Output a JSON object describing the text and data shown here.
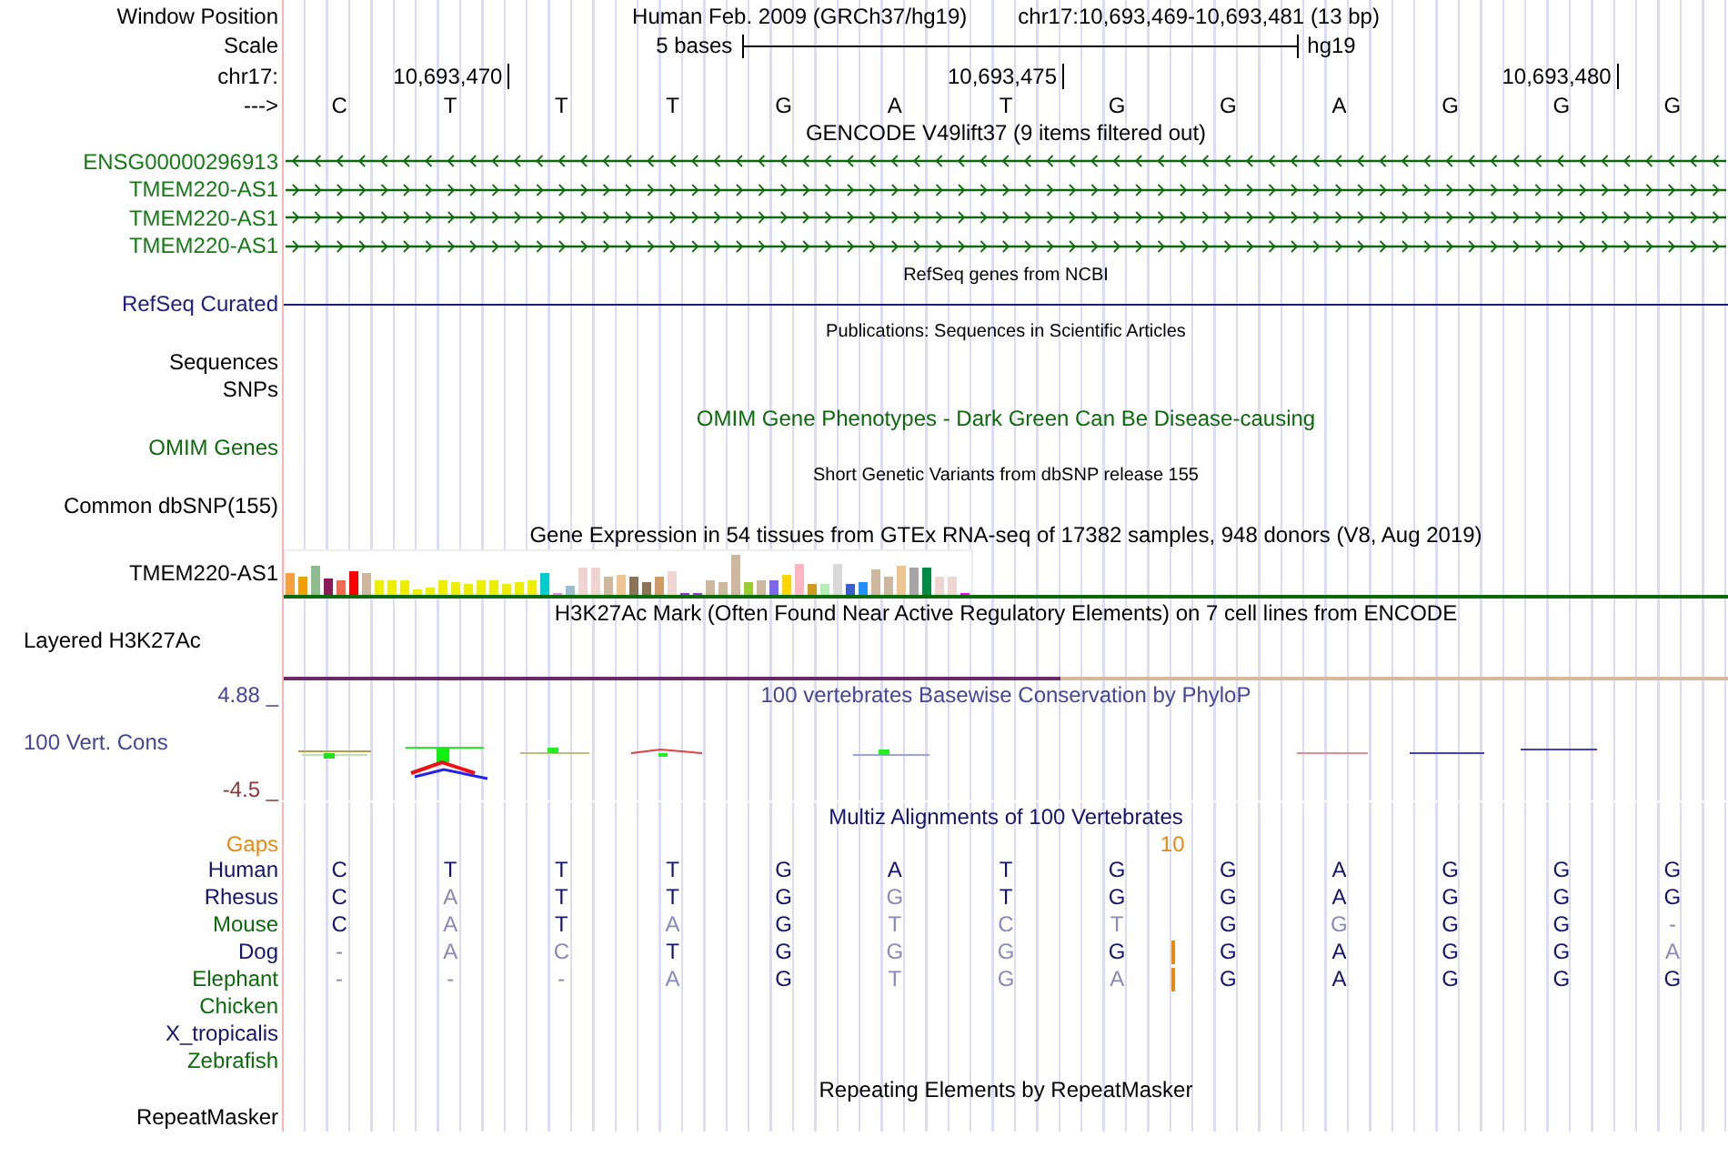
{
  "rows": [
    {
      "kind": "position",
      "label": "Window Position",
      "color": "#000000",
      "assembly": "Human Feb. 2009 (GRCh37/hg19)",
      "range": "chr17:10,693,469-10,693,481 (13 bp)"
    },
    {
      "kind": "scale",
      "label": "Scale",
      "color": "#000000",
      "span": "5 bases",
      "assembly": "hg19"
    },
    {
      "kind": "ruler",
      "label": "chr17:",
      "color": "#000000",
      "ticks": [
        "10,693,470",
        "10,693,475",
        "10,693,480"
      ]
    },
    {
      "kind": "bases",
      "label": "--->",
      "color": "#000000",
      "bases": [
        "C",
        "T",
        "T",
        "T",
        "G",
        "A",
        "T",
        "G",
        "G",
        "A",
        "G",
        "G",
        "G"
      ]
    },
    {
      "kind": "title",
      "text": "GENCODE V49lift37 (9 items filtered out)",
      "color": "#000000"
    },
    {
      "kind": "gene",
      "label": "ENSG00000296913",
      "color": "#157a15",
      "reverse": true
    },
    {
      "kind": "gene",
      "label": "TMEM220-AS1",
      "color": "#157a15",
      "reverse": false
    },
    {
      "kind": "gene",
      "label": "TMEM220-AS1",
      "color": "#157a15",
      "reverse": false
    },
    {
      "kind": "gene",
      "label": "TMEM220-AS1",
      "color": "#157a15",
      "reverse": false
    },
    {
      "kind": "small_title",
      "text": "RefSeq genes from NCBI",
      "color": "#000000"
    },
    {
      "kind": "line",
      "label": "RefSeq Curated",
      "color": "#1c1c80"
    },
    {
      "kind": "small_title",
      "text": "Publications: Sequences in Scientific Articles",
      "color": "#000000"
    },
    {
      "kind": "track",
      "label": "Sequences",
      "color": "#000000"
    },
    {
      "kind": "track",
      "label": "SNPs",
      "color": "#000000"
    },
    {
      "kind": "title",
      "text": "OMIM Gene Phenotypes - Dark Green Can Be Disease-causing",
      "color": "#0b6b0b"
    },
    {
      "kind": "track",
      "label": "OMIM Genes",
      "color": "#0b6b0b"
    },
    {
      "kind": "small_title",
      "text": "Short Genetic Variants from dbSNP release 155",
      "color": "#000000"
    },
    {
      "kind": "track",
      "label": "Common dbSNP(155)",
      "color": "#000000"
    },
    {
      "kind": "title",
      "text": "Gene Expression in 54 tissues from GTEx RNA-seq of 17382 samples, 948 donors (V8, Aug 2019)",
      "color": "#000000"
    },
    {
      "kind": "expression",
      "label": "TMEM220-AS1",
      "color": "#000000"
    },
    {
      "kind": "title",
      "text": "H3K27Ac Mark (Often Found Near Active Regulatory Elements) on 7 cell lines from ENCODE",
      "color": "#000000"
    },
    {
      "kind": "layered",
      "label": "Layered H3K27Ac",
      "color": "#000000"
    },
    {
      "kind": "conservation",
      "title": "100 vertebrates Basewise Conservation by PhyloP",
      "max": "4.88 _",
      "label": "100 Vert. Cons",
      "min": "-4.5 _",
      "color": "#45459a"
    },
    {
      "kind": "title",
      "text": "Multiz Alignments of 100 Vertebrates",
      "color": "#14146e"
    },
    {
      "kind": "gaps",
      "label": "Gaps",
      "count": "10",
      "color": "#e88a10"
    },
    {
      "kind": "species",
      "label": "Human",
      "color": "#14146e",
      "insertion": false,
      "bases": [
        {
          "b": "C",
          "faded": false
        },
        {
          "b": "T",
          "faded": false
        },
        {
          "b": "T",
          "faded": false
        },
        {
          "b": "T",
          "faded": false
        },
        {
          "b": "G",
          "faded": false
        },
        {
          "b": "A",
          "faded": false
        },
        {
          "b": "T",
          "faded": false
        },
        {
          "b": "G",
          "faded": false
        },
        {
          "b": "G",
          "faded": false
        },
        {
          "b": "A",
          "faded": false
        },
        {
          "b": "G",
          "faded": false
        },
        {
          "b": "G",
          "faded": false
        },
        {
          "b": "G",
          "faded": false
        }
      ]
    },
    {
      "kind": "species",
      "label": "Rhesus",
      "color": "#14146e",
      "insertion": false,
      "bases": [
        {
          "b": "C",
          "faded": false
        },
        {
          "b": "A",
          "faded": true
        },
        {
          "b": "T",
          "faded": false
        },
        {
          "b": "T",
          "faded": false
        },
        {
          "b": "G",
          "faded": false
        },
        {
          "b": "G",
          "faded": true
        },
        {
          "b": "T",
          "faded": false
        },
        {
          "b": "G",
          "faded": false
        },
        {
          "b": "G",
          "faded": false
        },
        {
          "b": "A",
          "faded": false
        },
        {
          "b": "G",
          "faded": false
        },
        {
          "b": "G",
          "faded": false
        },
        {
          "b": "G",
          "faded": false
        }
      ]
    },
    {
      "kind": "species",
      "label": "Mouse",
      "color": "#0b6b0b",
      "insertion": false,
      "bases": [
        {
          "b": "C",
          "faded": false
        },
        {
          "b": "A",
          "faded": true
        },
        {
          "b": "T",
          "faded": false
        },
        {
          "b": "A",
          "faded": true
        },
        {
          "b": "G",
          "faded": false
        },
        {
          "b": "T",
          "faded": true
        },
        {
          "b": "C",
          "faded": true
        },
        {
          "b": "T",
          "faded": true
        },
        {
          "b": "G",
          "faded": false
        },
        {
          "b": "G",
          "faded": true
        },
        {
          "b": "G",
          "faded": false
        },
        {
          "b": "G",
          "faded": false
        },
        {
          "b": "-",
          "faded": true
        }
      ]
    },
    {
      "kind": "species",
      "label": "Dog",
      "color": "#14146e",
      "insertion": true,
      "bases": [
        {
          "b": "-",
          "faded": true
        },
        {
          "b": "A",
          "faded": true
        },
        {
          "b": "C",
          "faded": true
        },
        {
          "b": "T",
          "faded": false
        },
        {
          "b": "G",
          "faded": false
        },
        {
          "b": "G",
          "faded": true
        },
        {
          "b": "G",
          "faded": true
        },
        {
          "b": "G",
          "faded": false
        },
        {
          "b": "G",
          "faded": false
        },
        {
          "b": "A",
          "faded": false
        },
        {
          "b": "G",
          "faded": false
        },
        {
          "b": "G",
          "faded": false
        },
        {
          "b": "A",
          "faded": true
        }
      ]
    },
    {
      "kind": "species",
      "label": "Elephant",
      "color": "#0b6b0b",
      "insertion": true,
      "bases": [
        {
          "b": "-",
          "faded": true
        },
        {
          "b": "-",
          "faded": true
        },
        {
          "b": "-",
          "faded": true
        },
        {
          "b": "A",
          "faded": true
        },
        {
          "b": "G",
          "faded": false
        },
        {
          "b": "T",
          "faded": true
        },
        {
          "b": "G",
          "faded": true
        },
        {
          "b": "A",
          "faded": true
        },
        {
          "b": "G",
          "faded": false
        },
        {
          "b": "A",
          "faded": false
        },
        {
          "b": "G",
          "faded": false
        },
        {
          "b": "G",
          "faded": false
        },
        {
          "b": "G",
          "faded": false
        }
      ]
    },
    {
      "kind": "species",
      "label": "Chicken",
      "color": "#0b6b0b",
      "insertion": false
    },
    {
      "kind": "species",
      "label": "X_tropicalis",
      "color": "#14146e",
      "insertion": false
    },
    {
      "kind": "species",
      "label": "Zebrafish",
      "color": "#0b6b0b",
      "insertion": false
    },
    {
      "kind": "title",
      "text": "Repeating Elements by RepeatMasker",
      "color": "#000000"
    },
    {
      "kind": "track",
      "label": "RepeatMasker",
      "color": "#000000"
    }
  ]
}
